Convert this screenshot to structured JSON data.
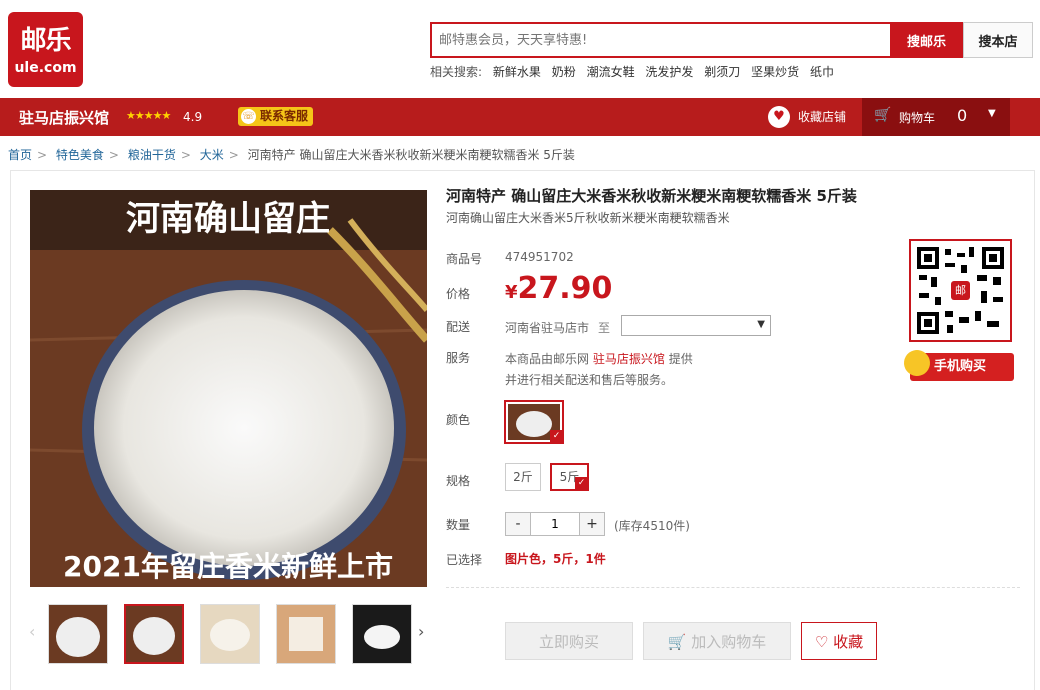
{
  "header": {
    "logo_cn": "邮乐",
    "logo_en": "ule.com",
    "search_placeholder": "邮特惠会员，天天享特惠!",
    "search_ule_label": "搜邮乐",
    "search_store_label": "搜本店",
    "hot_search_label": "相关搜索:",
    "hot_search_keywords": [
      "新鲜水果",
      "奶粉",
      "潮流女鞋",
      "洗发护发",
      "剃须刀",
      "坚果炒货",
      "纸巾"
    ]
  },
  "storebar": {
    "store_name": "驻马店振兴馆",
    "stars": "★★★★★",
    "rating": "4.9",
    "customer_service": "联系客服",
    "favorite_label": "收藏店铺",
    "cart_label": "购物车",
    "cart_count": "0"
  },
  "breadcrumb": {
    "items": [
      "首页",
      "特色美食",
      "粮油干货",
      "大米"
    ],
    "current": "河南特产 确山留庄大米香米秋收新米粳米南粳软糯香米 5斤装"
  },
  "product": {
    "image_caption_top": "河南确山留庄",
    "image_caption_bottom": "2021年留庄香米新鲜上市",
    "title": "河南特产 确山留庄大米香米秋收新米粳米南粳软糯香米 5斤装",
    "subtitle": "河南确山留庄大米香米5斤秋收新米粳米南粳软糯香米",
    "sku_label": "商品号",
    "sku": "474951702",
    "price_label": "价格",
    "price_currency": "¥",
    "price": "27.90",
    "ship_label": "配送",
    "ship_from": "河南省驻马店市",
    "ship_to": "至",
    "service_label": "服务",
    "service_line1_prefix": "本商品由邮乐网",
    "service_store": "驻马店振兴馆",
    "service_line1_suffix": "提供",
    "service_line2": "并进行相关配送和售后等服务。",
    "color_label": "颜色",
    "spec_label": "规格",
    "specs": [
      "2斤",
      "5斤"
    ],
    "qty_label": "数量",
    "qty_minus": "-",
    "qty_value": "1",
    "qty_plus": "+",
    "stock": "(库存4510件)",
    "selected_label": "已选择",
    "selected_value": "图片色，5斤，1件",
    "buy_now": "立即购买",
    "add_cart": "加入购物车",
    "collect": "收藏",
    "mobile_buy": "手机购买",
    "qr_badge": "邮"
  },
  "colors": {
    "brand_red": "#c8161d",
    "store_bar": "#b71c1c",
    "link_blue": "#226699"
  }
}
